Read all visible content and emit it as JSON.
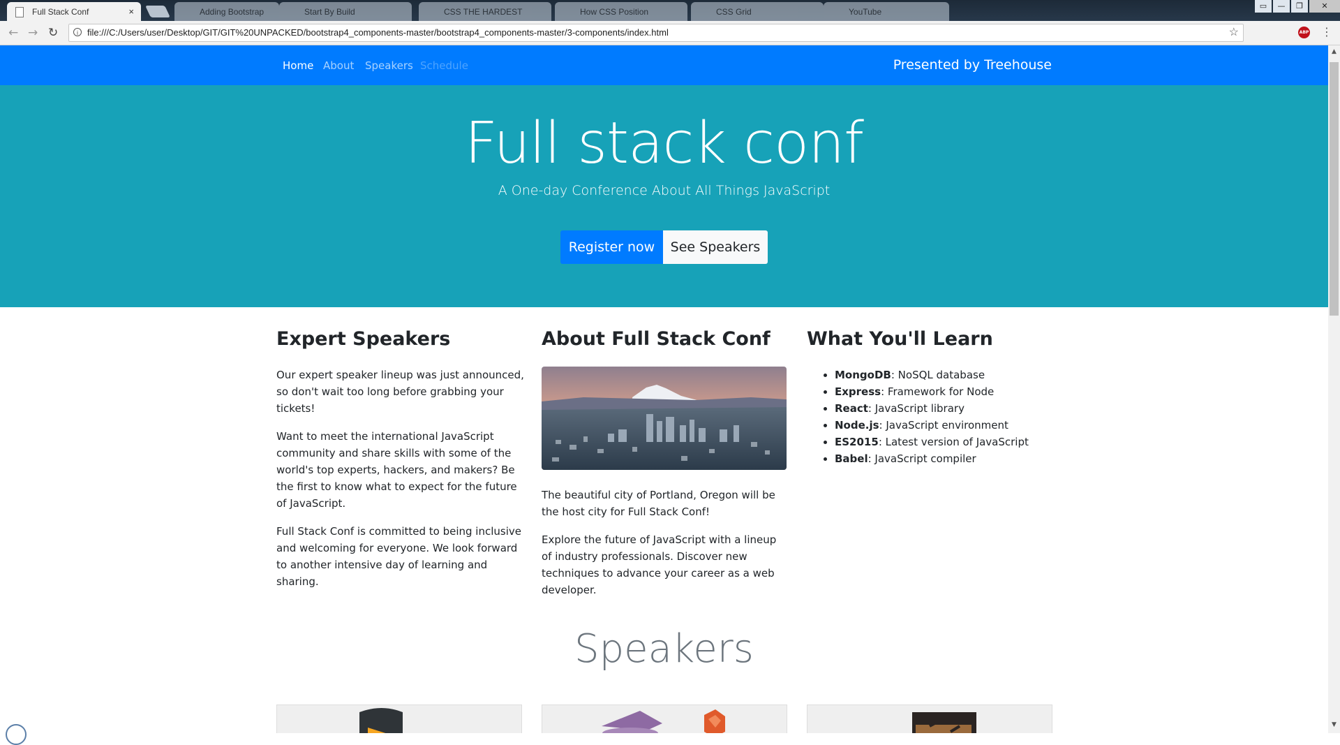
{
  "browser": {
    "active_tab_title": "Full Stack Conf",
    "tab_close_glyph": "×",
    "background_tabs": [
      "Adding Bootstrap",
      "Start By Build",
      "CSS THE HARDEST",
      "How CSS Position",
      "CSS Grid",
      "YouTube"
    ],
    "url": "file:///C:/Users/user/Desktop/GIT/GIT%20UNPACKED/bootstrap4_components-master/bootstrap4_components-master/3-components/index.html",
    "extension_badge": "ABP",
    "window_controls": [
      "▭",
      "—",
      "❐",
      "✕"
    ]
  },
  "nav": {
    "links": [
      "Home",
      "About",
      "Speakers",
      "Schedule"
    ],
    "presented": "Presented by Treehouse"
  },
  "hero": {
    "title": "Full stack conf",
    "subtitle": "A One-day Conference About All Things JavaScript",
    "primary_button": "Register now",
    "secondary_button": "See Speakers"
  },
  "columns": {
    "speakers": {
      "heading": "Expert Speakers",
      "paragraphs": [
        "Our expert speaker lineup was just announced, so don't wait too long before grabbing your tickets!",
        "Want to meet the international JavaScript community and share skills with some of the world's top experts, hackers, and makers? Be the first to know what to expect for the future of JavaScript.",
        "Full Stack Conf is committed to being inclusive and welcoming for everyone. We look forward to another intensive day of learning and sharing."
      ]
    },
    "about": {
      "heading": "About Full Stack Conf",
      "paragraphs": [
        "The beautiful city of Portland, Oregon will be the host city for Full Stack Conf!",
        "Explore the future of JavaScript with a lineup of industry professionals. Discover new techniques to advance your career as a web developer."
      ]
    },
    "learn": {
      "heading": "What You'll Learn",
      "items": [
        {
          "term": "MongoDB",
          "desc": ": NoSQL database"
        },
        {
          "term": "Express",
          "desc": ": Framework for Node"
        },
        {
          "term": "React",
          "desc": ": JavaScript library"
        },
        {
          "term": "Node.js",
          "desc": ": JavaScript environment"
        },
        {
          "term": "ES2015",
          "desc": ": Latest version of JavaScript"
        },
        {
          "term": "Babel",
          "desc": ": JavaScript compiler"
        }
      ]
    }
  },
  "speakers_section": {
    "title": "Speakers"
  },
  "colors": {
    "nav_bg": "#007bff",
    "hero_bg": "#17a2b8",
    "primary": "#007bff",
    "light": "#f8f9fa"
  }
}
